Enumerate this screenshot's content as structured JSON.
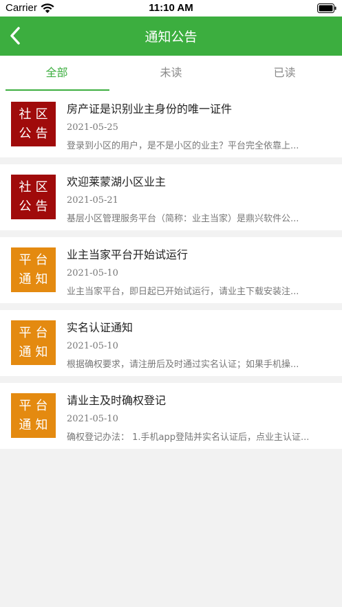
{
  "status_bar": {
    "carrier": "Carrier",
    "time": "11:10 AM"
  },
  "nav": {
    "title": "通知公告",
    "back_icon": "chevron-left-icon"
  },
  "tabs": [
    {
      "label": "全部",
      "active": true
    },
    {
      "label": "未读",
      "active": false
    },
    {
      "label": "已读",
      "active": false
    }
  ],
  "notices": [
    {
      "badge_line1": "社区",
      "badge_line2": "公告",
      "badge_color": "#a00b0b",
      "title": "房产证是识别业主身份的唯一证件",
      "date": "2021-05-25",
      "summary": "登录到小区的用户，是不是小区的业主？平台完全依靠上..."
    },
    {
      "badge_line1": "社区",
      "badge_line2": "公告",
      "badge_color": "#a00b0b",
      "title": "欢迎莱蒙湖小区业主",
      "date": "2021-05-21",
      "summary": "基层小区管理服务平台（简称：业主当家）是鼎兴软件公..."
    },
    {
      "badge_line1": "平台",
      "badge_line2": "通知",
      "badge_color": "#e48a10",
      "title": "业主当家平台开始试运行",
      "date": "2021-05-10",
      "summary": "业主当家平台，即日起已开始试运行，请业主下载安装注..."
    },
    {
      "badge_line1": "平台",
      "badge_line2": "通知",
      "badge_color": "#e48a10",
      "title": "实名认证通知",
      "date": "2021-05-10",
      "summary": "根据确权要求，请注册后及时通过实名认证；如果手机操..."
    },
    {
      "badge_line1": "平台",
      "badge_line2": "通知",
      "badge_color": "#e48a10",
      "title": "请业主及时确权登记",
      "date": "2021-05-10",
      "summary": "确权登记办法： 1.手机app登陆并实名认证后，点业主认证..."
    }
  ],
  "colors": {
    "accent": "#3cae3f",
    "community_badge": "#a00b0b",
    "platform_badge": "#e48a10"
  }
}
